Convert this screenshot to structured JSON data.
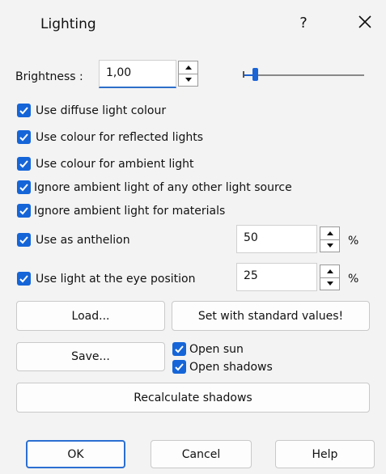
{
  "window": {
    "title": "Lighting",
    "help": "?"
  },
  "brightness": {
    "label": "Brightness :",
    "value": "1,00",
    "slider_fraction": 0.1
  },
  "options": [
    {
      "label": "Use diffuse light colour",
      "checked": true
    },
    {
      "label": "Use colour for reflected lights",
      "checked": true
    },
    {
      "label": "Use colour for ambient light",
      "checked": true
    },
    {
      "label": "Ignore ambient light of any other light source",
      "checked": true
    },
    {
      "label": "Ignore ambient light for materials",
      "checked": true
    }
  ],
  "anthelion": {
    "label": "Use as anthelion",
    "checked": true,
    "value": "50",
    "unit": "%"
  },
  "eye_light": {
    "label": "Use light at the eye position",
    "checked": true,
    "value": "25",
    "unit": "%"
  },
  "buttons": {
    "load": "Load...",
    "standard": "Set with standard values!",
    "save": "Save...",
    "recalc": "Recalculate shadows",
    "ok": "OK",
    "cancel": "Cancel",
    "help": "Help"
  },
  "open_sun": {
    "label": "Open sun",
    "checked": true
  },
  "open_shadows": {
    "label": "Open shadows",
    "checked": true
  },
  "colors": {
    "accent": "#1565d8",
    "background": "#f3f3f3",
    "button_bg": "#fdfdfd"
  }
}
